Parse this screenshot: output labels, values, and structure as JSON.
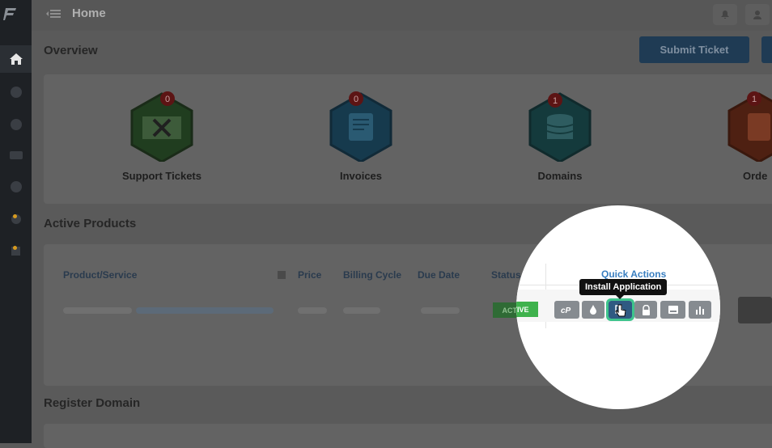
{
  "header": {
    "title": "Home"
  },
  "sections": {
    "overview": "Overview",
    "active_products": "Active Products",
    "register_domain": "Register Domain"
  },
  "toolbar": {
    "submit_ticket": "Submit Ticket"
  },
  "stats": [
    {
      "label": "Support Tickets",
      "count": "0",
      "icon": "ticket-tools-icon",
      "color": "#2e7d32"
    },
    {
      "label": "Invoices",
      "count": "0",
      "icon": "invoice-dollar-icon",
      "color": "#1e88b4"
    },
    {
      "label": "Domains",
      "count": "1",
      "icon": "database-icon",
      "color": "#1b7a86"
    },
    {
      "label": "Orde",
      "count": "1",
      "icon": "order-clipboard-icon",
      "color": "#d84315"
    }
  ],
  "table": {
    "headers": [
      "Product/Service",
      "Price",
      "Billing Cycle",
      "Due Date",
      "Status"
    ],
    "status": "ACTIVE",
    "quick_actions_title": "Quick Actions"
  },
  "quick_actions": {
    "tooltip": "Install Application",
    "buttons": [
      "cpanel-icon",
      "drop-icon",
      "install-app-icon",
      "lock-icon",
      "sql-icon",
      "bar-chart-icon"
    ]
  }
}
